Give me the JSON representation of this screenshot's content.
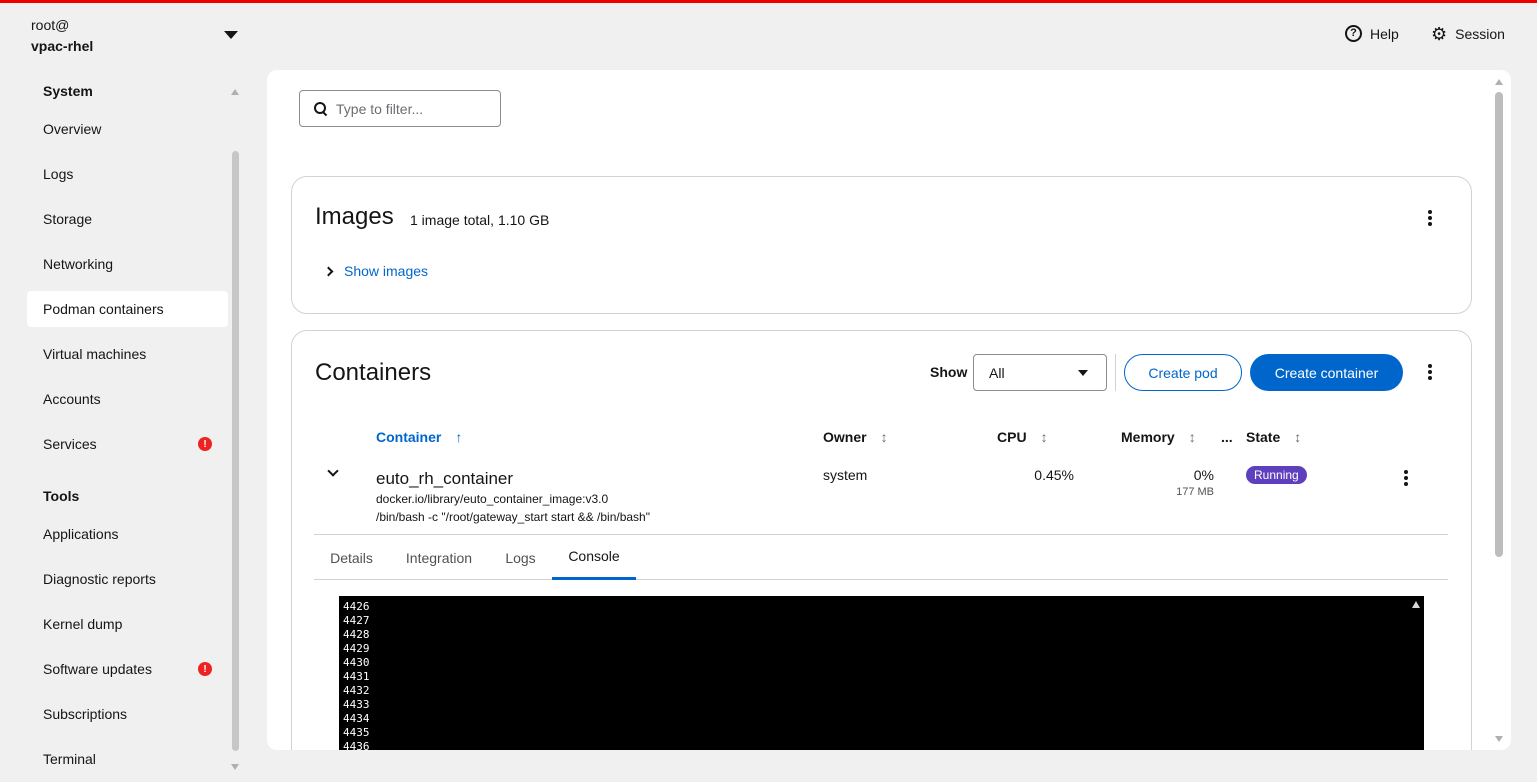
{
  "host": {
    "user": "root@",
    "name": "vpac-rhel"
  },
  "header": {
    "help_label": "Help",
    "session_label": "Session"
  },
  "sidebar": {
    "sections": [
      {
        "heading": "System",
        "items": [
          "Overview",
          "Logs",
          "Storage",
          "Networking",
          "Podman containers",
          "Virtual machines",
          "Accounts",
          "Services"
        ]
      },
      {
        "heading": "Tools",
        "items": [
          "Applications",
          "Diagnostic reports",
          "Kernel dump",
          "Software updates",
          "Subscriptions",
          "Terminal"
        ]
      }
    ],
    "active_item": "Podman containers",
    "error_badges": [
      "Services",
      "Software updates"
    ],
    "badge_glyph": "!"
  },
  "filter": {
    "placeholder": "Type to filter..."
  },
  "images_card": {
    "title": "Images",
    "summary": "1 image total, 1.10 GB",
    "toggle_label": "Show images"
  },
  "containers_card": {
    "title": "Containers",
    "show_label": "Show",
    "show_value": "All",
    "create_pod_label": "Create pod",
    "create_container_label": "Create container",
    "columns": {
      "container": "Container",
      "owner": "Owner",
      "cpu": "CPU",
      "memory": "Memory",
      "ellipsis": "...",
      "state": "State"
    },
    "row": {
      "name": "euto_rh_container",
      "image": "docker.io/library/euto_container_image:v3.0",
      "command": "/bin/bash -c \"/root/gateway_start start && /bin/bash\"",
      "owner": "system",
      "cpu": "0.45%",
      "memory": "0%",
      "memory_detail": "177 MB",
      "state": "Running"
    },
    "tabs": [
      "Details",
      "Integration",
      "Logs",
      "Console"
    ],
    "active_tab": "Console",
    "console_lines": [
      "4426",
      "4427",
      "4428",
      "4429",
      "4430",
      "4431",
      "4432",
      "4433",
      "4434",
      "4435",
      "4436"
    ]
  },
  "colors": {
    "accent": "#0066cc",
    "topline": "#ee0000",
    "running": "#5e40be",
    "error": "#ee2222"
  }
}
